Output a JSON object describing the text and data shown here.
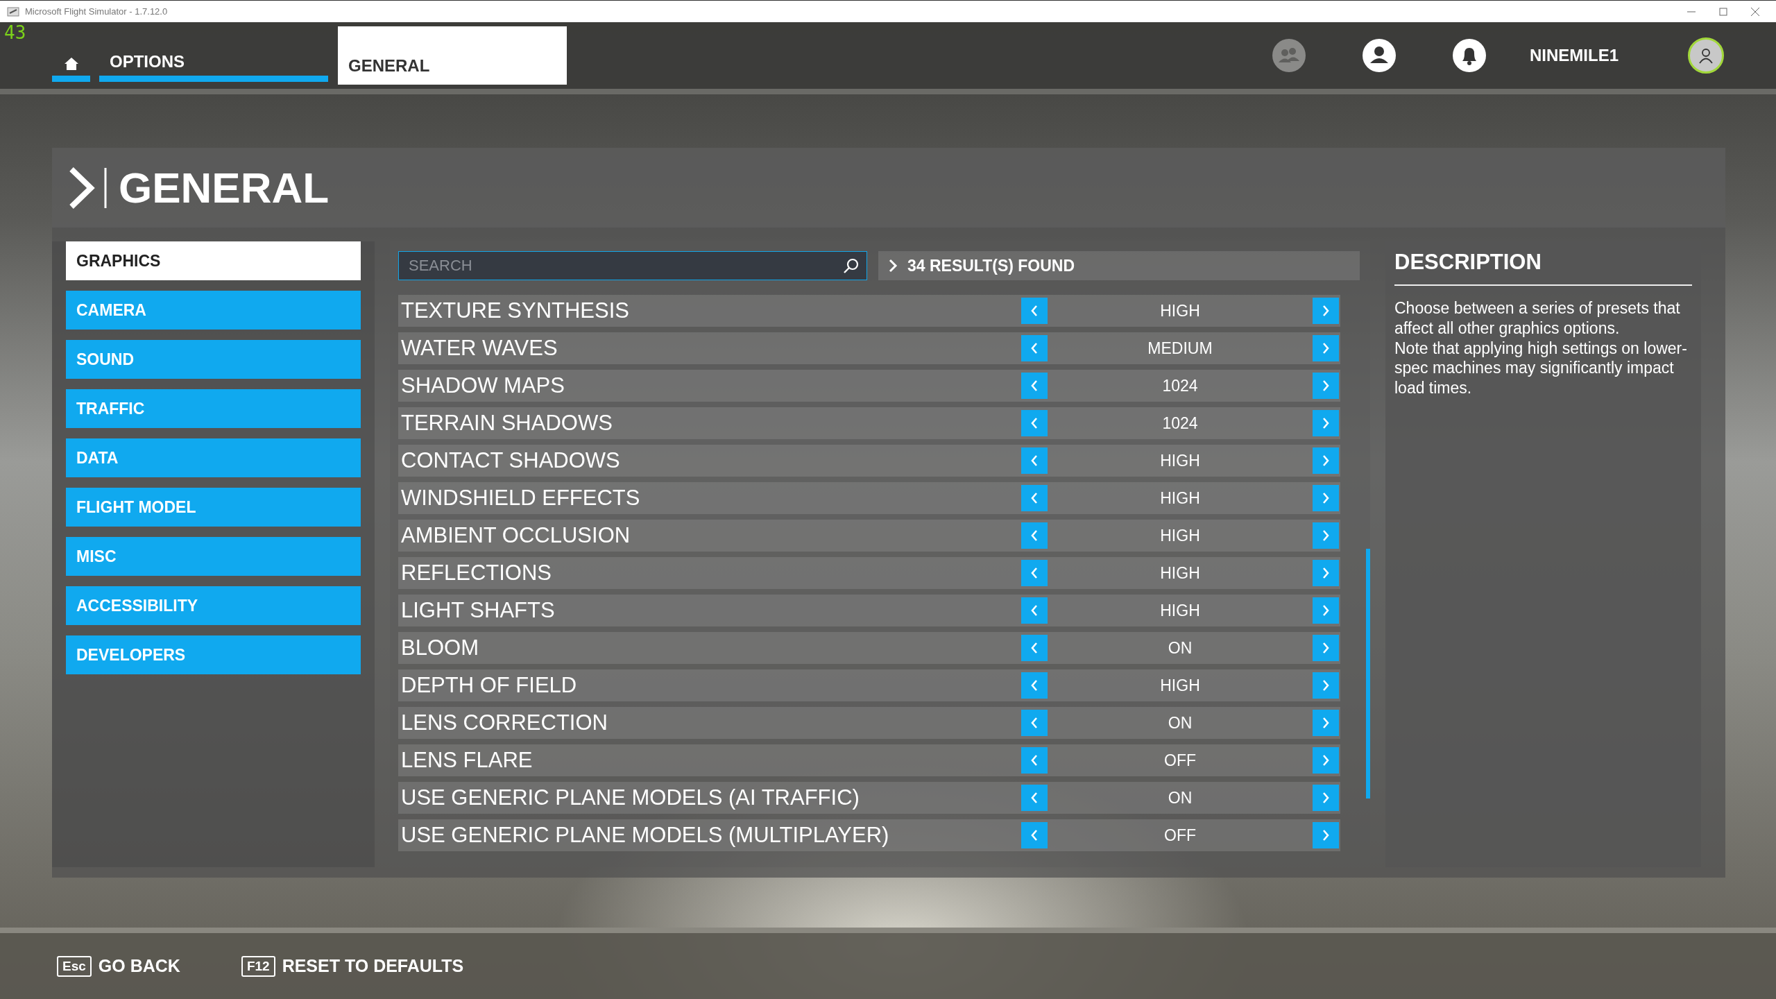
{
  "window": {
    "title": "Microsoft Flight Simulator - 1.7.12.0"
  },
  "fps_counter": "43",
  "nav": {
    "tabs": [
      {
        "label": "OPTIONS",
        "selected": false
      },
      {
        "label": "GENERAL",
        "selected": true
      }
    ],
    "username": "NINEMILE1"
  },
  "page_title": "GENERAL",
  "sidebar": {
    "items": [
      {
        "label": "GRAPHICS",
        "selected": true
      },
      {
        "label": "CAMERA",
        "selected": false
      },
      {
        "label": "SOUND",
        "selected": false
      },
      {
        "label": "TRAFFIC",
        "selected": false
      },
      {
        "label": "DATA",
        "selected": false
      },
      {
        "label": "FLIGHT MODEL",
        "selected": false
      },
      {
        "label": "MISC",
        "selected": false
      },
      {
        "label": "ACCESSIBILITY",
        "selected": false
      },
      {
        "label": "DEVELOPERS",
        "selected": false
      }
    ]
  },
  "search": {
    "placeholder": "SEARCH"
  },
  "results": "34 RESULT(S) FOUND",
  "settings": [
    {
      "label": "TEXTURE SYNTHESIS",
      "value": "HIGH"
    },
    {
      "label": "WATER WAVES",
      "value": "MEDIUM"
    },
    {
      "label": "SHADOW MAPS",
      "value": "1024"
    },
    {
      "label": "TERRAIN SHADOWS",
      "value": "1024"
    },
    {
      "label": "CONTACT SHADOWS",
      "value": "HIGH"
    },
    {
      "label": "WINDSHIELD EFFECTS",
      "value": "HIGH"
    },
    {
      "label": "AMBIENT OCCLUSION",
      "value": "HIGH"
    },
    {
      "label": "REFLECTIONS",
      "value": "HIGH"
    },
    {
      "label": "LIGHT SHAFTS",
      "value": "HIGH"
    },
    {
      "label": "BLOOM",
      "value": "ON"
    },
    {
      "label": "DEPTH OF FIELD",
      "value": "HIGH"
    },
    {
      "label": "LENS CORRECTION",
      "value": "ON"
    },
    {
      "label": "LENS FLARE",
      "value": "OFF"
    },
    {
      "label": "USE GENERIC PLANE MODELS (AI TRAFFIC)",
      "value": "ON"
    },
    {
      "label": "USE GENERIC PLANE MODELS (MULTIPLAYER)",
      "value": "OFF"
    }
  ],
  "description": {
    "title": "DESCRIPTION",
    "text": "Choose between a series of presets that affect all other graphics options.\nNote that applying high settings on lower-spec machines may significantly impact load times."
  },
  "footer": [
    {
      "key": "Esc",
      "label": "GO BACK"
    },
    {
      "key": "F12",
      "label": "RESET TO DEFAULTS"
    }
  ]
}
